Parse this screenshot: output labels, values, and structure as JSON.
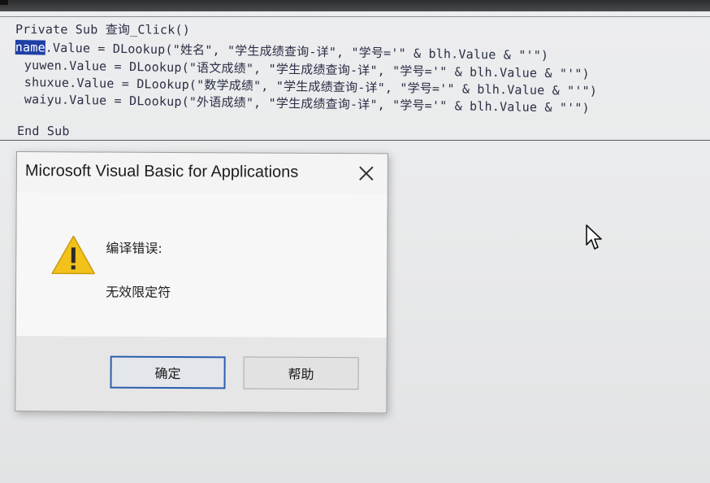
{
  "code_editor": {
    "lines": [
      "Private Sub 查询_Click()",
      ".Value = DLookup(\"姓名\", \"学生成绩查询-详\", \"学号='\" & blh.Value & \"'\")",
      "yuwen.Value = DLookup(\"语文成绩\", \"学生成绩查询-详\", \"学号='\" & blh.Value & \"'\")",
      "shuxue.Value = DLookup(\"数学成绩\", \"学生成绩查询-详\", \"学号='\" & blh.Value & \"'\")",
      "waiyu.Value = DLookup(\"外语成绩\", \"学生成绩查询-详\", \"学号='\" & blh.Value & \"'\")",
      "End Sub"
    ],
    "selected_word": "name"
  },
  "dialog": {
    "title": "Microsoft Visual Basic for Applications",
    "icon": "warning-icon",
    "message_title": "编译错误:",
    "message_detail": "无效限定符",
    "ok_label": "确定",
    "help_label": "帮助"
  },
  "colors": {
    "selection": "#1f3fa6",
    "warning_yellow": "#f2c21b",
    "default_button_border": "#2a5fae"
  }
}
